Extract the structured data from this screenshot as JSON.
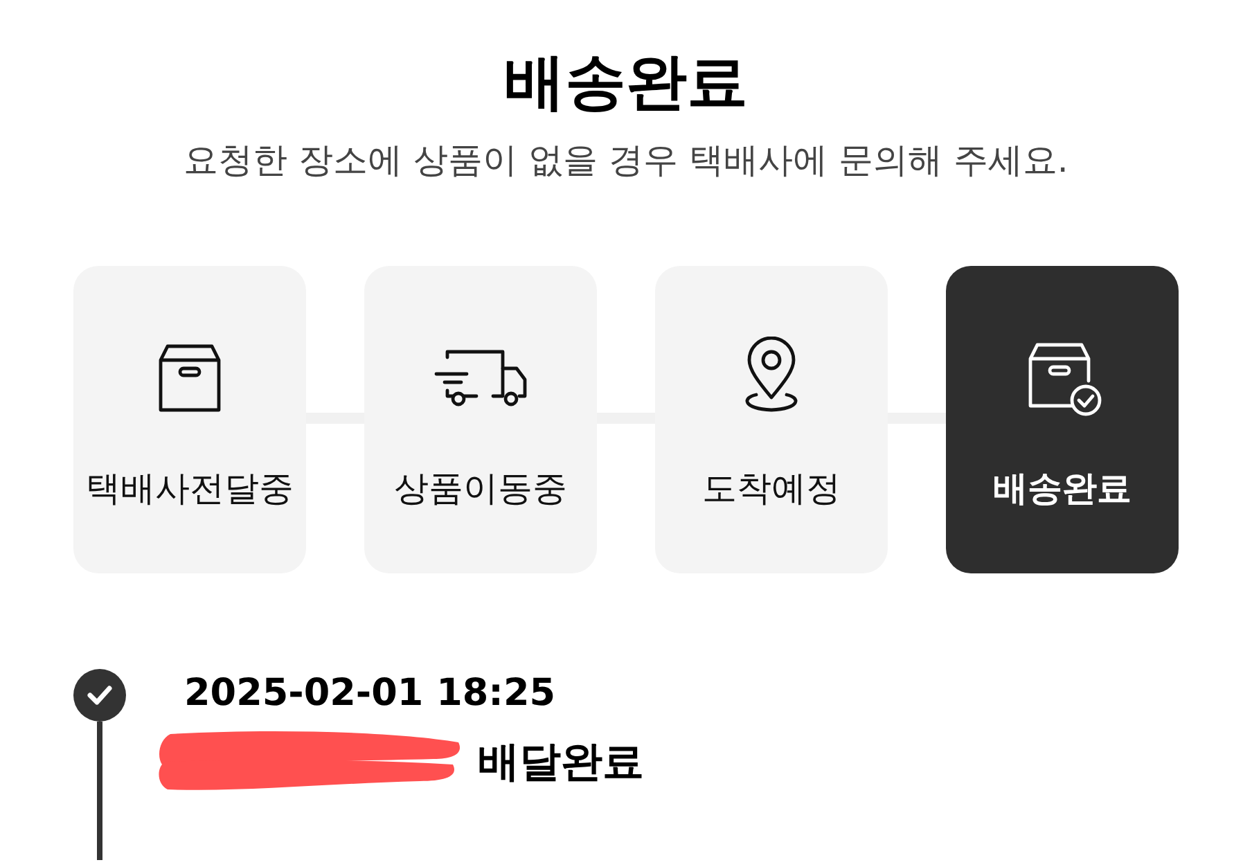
{
  "header": {
    "title": "배송완료",
    "subtitle": "요청한 장소에 상품이 없을 경우 택배사에 문의해 주세요."
  },
  "steps": [
    {
      "kind": "box",
      "label": "택배사전달중",
      "selected": false
    },
    {
      "kind": "truck",
      "label": "상품이동중",
      "selected": false
    },
    {
      "kind": "pin",
      "label": "도착예정",
      "selected": false
    },
    {
      "kind": "box-check",
      "label": "배송완료",
      "selected": true
    }
  ],
  "timeline": [
    {
      "time": "2025-02-01 18:25",
      "status": "배달완료",
      "done": true,
      "redacted": true
    }
  ]
}
